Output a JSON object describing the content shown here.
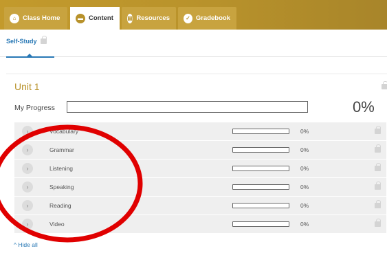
{
  "nav": {
    "tabs": [
      {
        "label": "Class Home",
        "icon": "home-icon",
        "active": false
      },
      {
        "label": "Content",
        "icon": "content-icon",
        "active": true
      },
      {
        "label": "Resources",
        "icon": "resources-icon",
        "active": false
      },
      {
        "label": "Gradebook",
        "icon": "gradebook-icon",
        "active": false
      }
    ]
  },
  "subnav": {
    "label": "Self-Study",
    "locked": true
  },
  "unit": {
    "title": "Unit 1",
    "progress_label": "My Progress",
    "progress_value": 0,
    "progress_text": "0%",
    "locked": true
  },
  "items": [
    {
      "label": "Vocabulary",
      "progress": 0,
      "progress_text": "0%"
    },
    {
      "label": "Grammar",
      "progress": 0,
      "progress_text": "0%"
    },
    {
      "label": "Listening",
      "progress": 0,
      "progress_text": "0%"
    },
    {
      "label": "Speaking",
      "progress": 0,
      "progress_text": "0%"
    },
    {
      "label": "Reading",
      "progress": 0,
      "progress_text": "0%"
    },
    {
      "label": "Video",
      "progress": 0,
      "progress_text": "0%"
    }
  ],
  "footer": {
    "hide_all": "Hide all"
  },
  "colors": {
    "brand": "#b8922b",
    "link": "#2878b5",
    "annotation": "#e00000"
  }
}
